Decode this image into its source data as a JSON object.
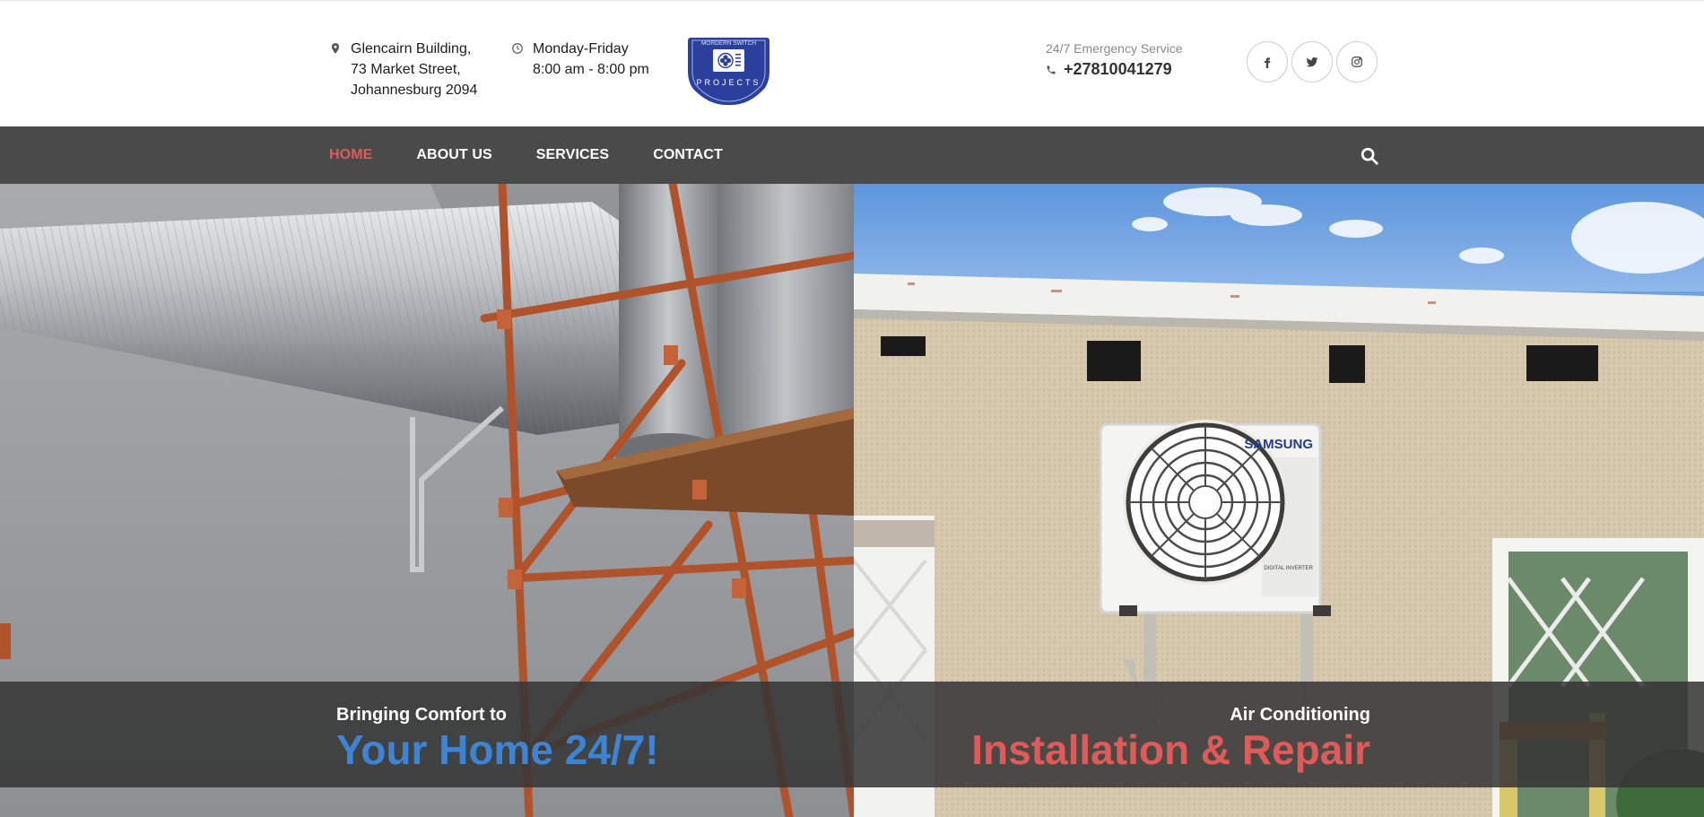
{
  "topbar": {
    "address": {
      "line1": "Glencairn Building,",
      "line2": "73 Market Street,",
      "line3": "Johannesburg 2094",
      "icon": "map-pin-icon"
    },
    "hours": {
      "line1": "Monday-Friday",
      "line2": "8:00 am - 8:00 pm",
      "icon": "clock-icon"
    },
    "logo": {
      "top_text": "MORDERN SWITCH",
      "bottom_text": "PROJECTS"
    },
    "emergency": {
      "label": "24/7 Emergency Service",
      "phone": "+27810041279",
      "icon": "phone-icon"
    },
    "socials": [
      {
        "name": "facebook",
        "glyph": "f"
      },
      {
        "name": "twitter",
        "glyph": "twitter-bird"
      },
      {
        "name": "instagram",
        "glyph": "instagram-camera"
      }
    ]
  },
  "nav": {
    "items": [
      {
        "label": "HOME",
        "active": true
      },
      {
        "label": "ABOUT US",
        "active": false
      },
      {
        "label": "SERVICES",
        "active": false
      },
      {
        "label": "CONTACT",
        "active": false
      }
    ],
    "search_icon": "search-icon"
  },
  "hero": {
    "left": {
      "small": "Bringing Comfort to",
      "big": "Your Home 24/7!"
    },
    "right": {
      "small": "Air Conditioning",
      "big": "Installation & Repair"
    },
    "unit_brand": "SAMSUNG",
    "unit_model": "DIGITAL INVERTER"
  },
  "colors": {
    "nav_bg": "#4a4a4a",
    "accent_red": "#e05a5a",
    "accent_blue": "#3e84d4",
    "logo_blue": "#2b3f9c"
  }
}
